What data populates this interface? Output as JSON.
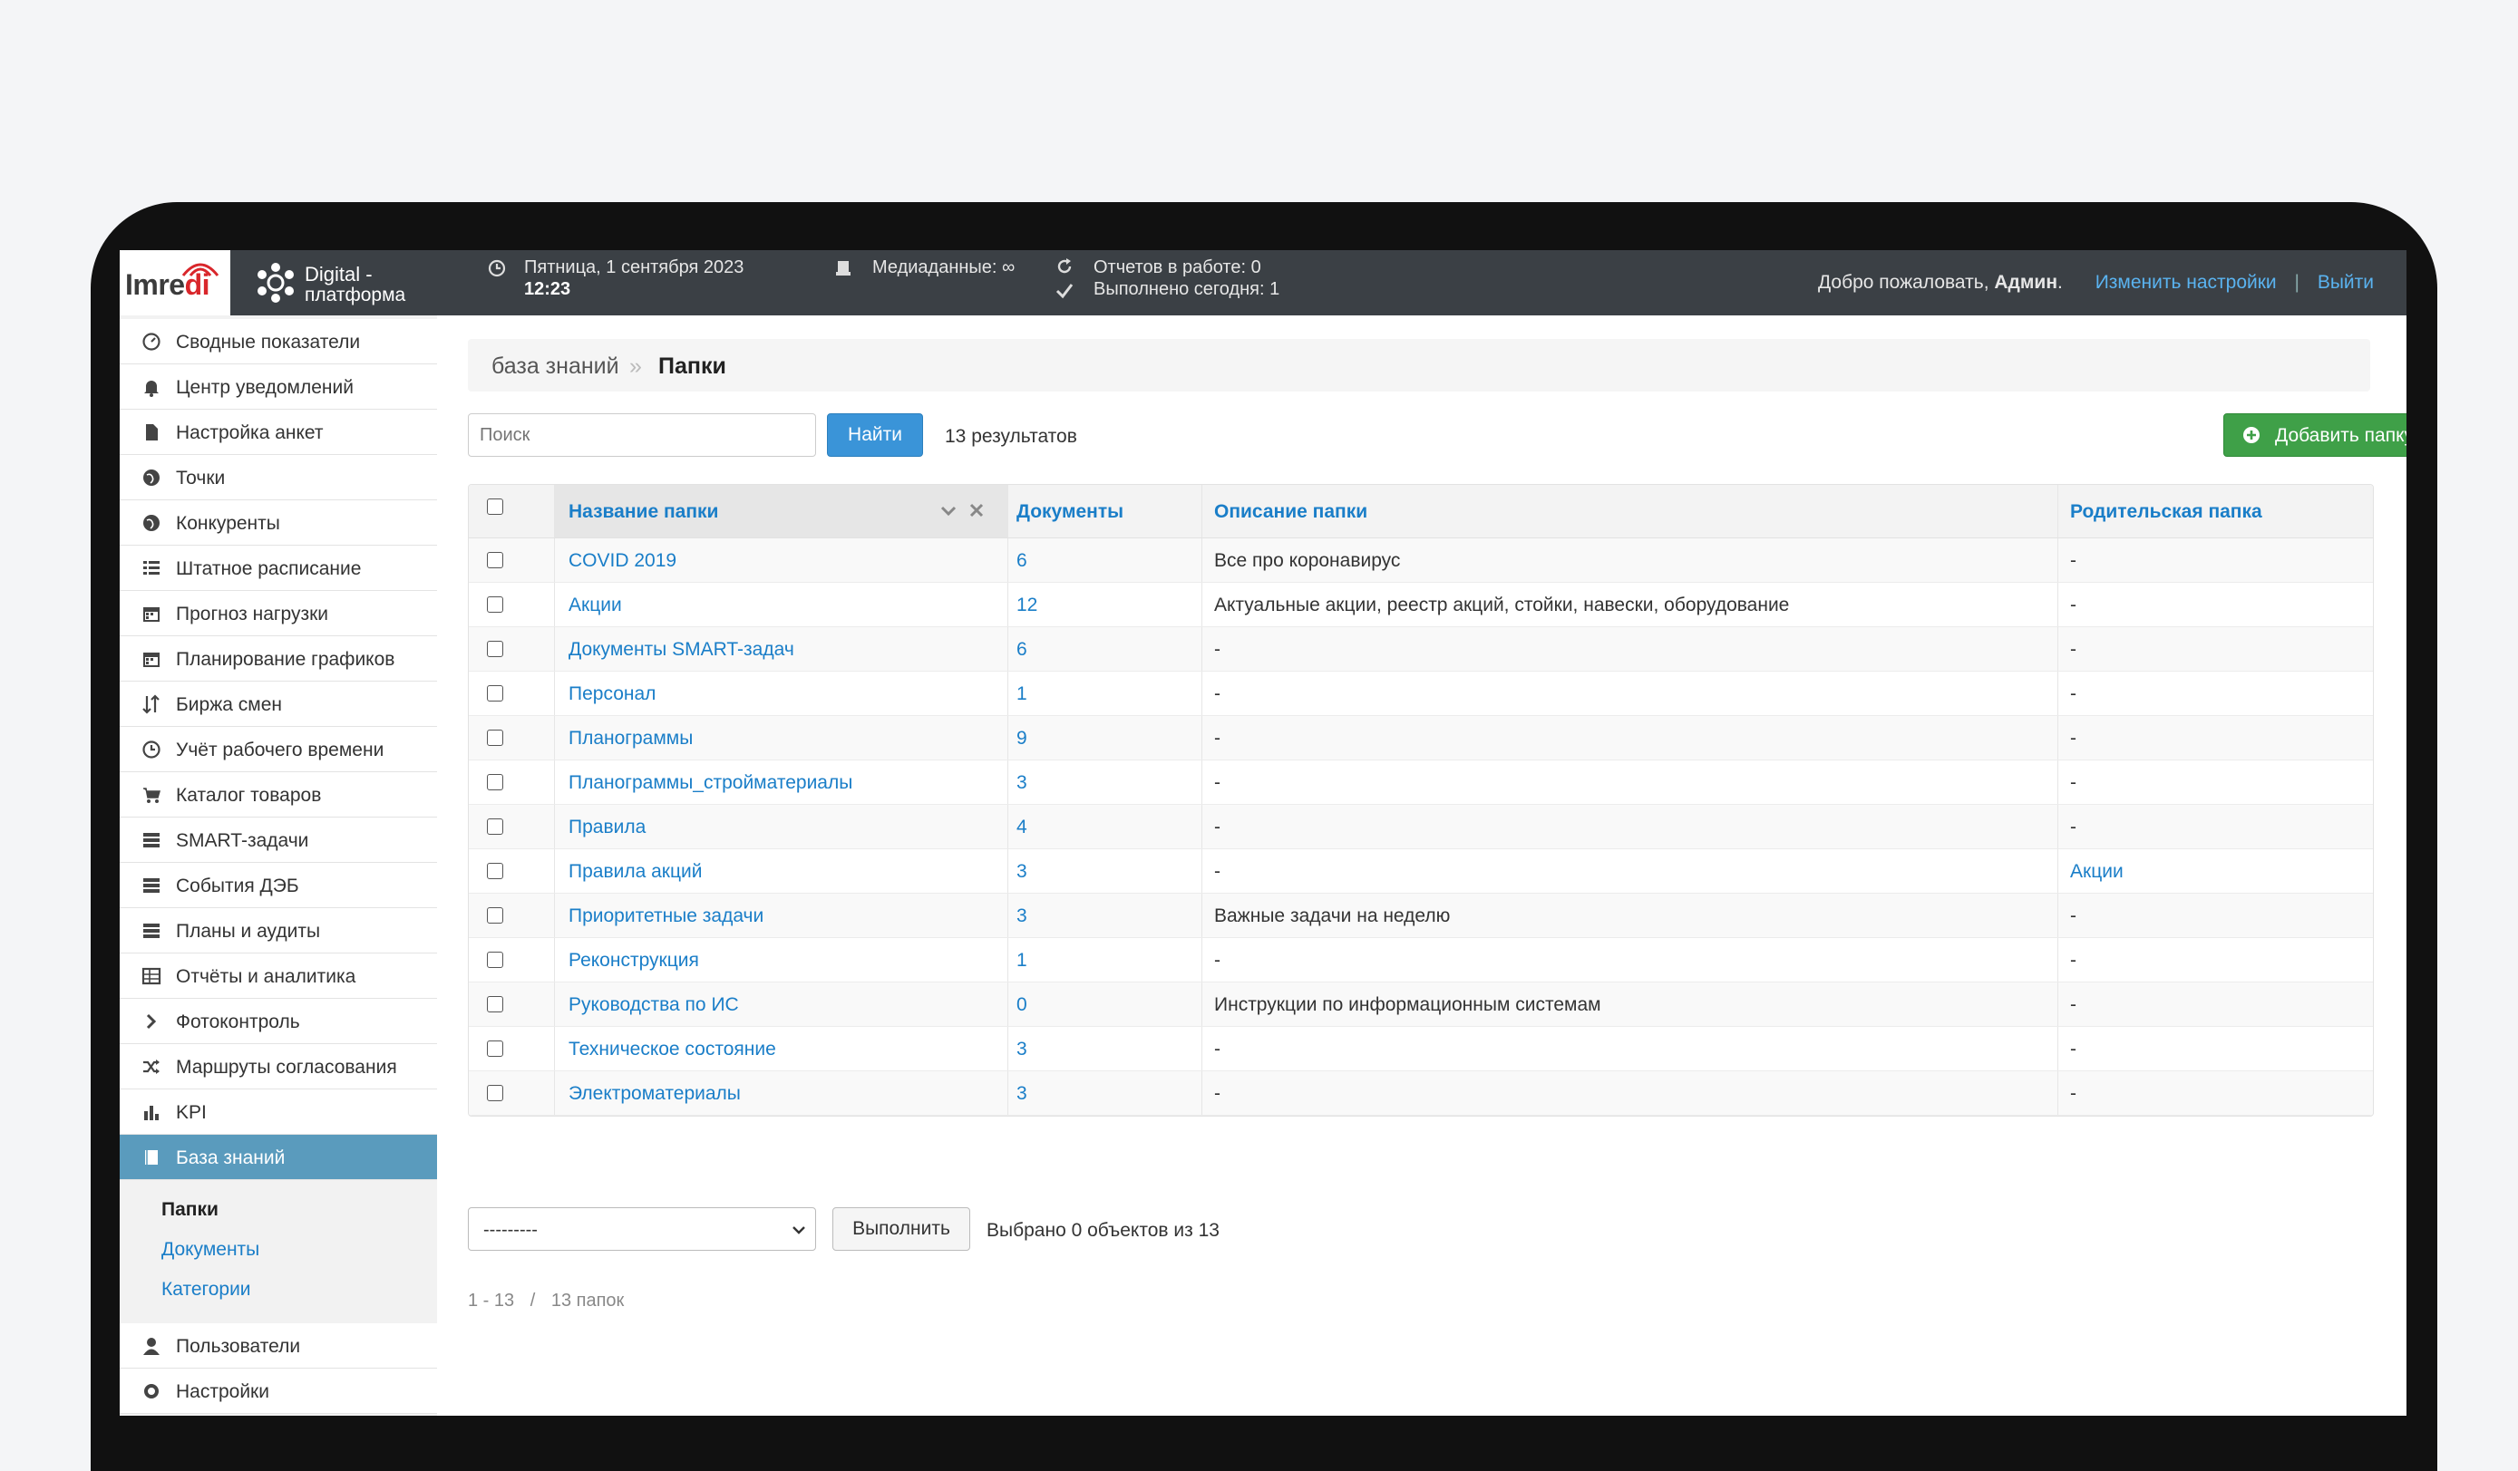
{
  "topbar": {
    "logo_prefix": "Imre",
    "logo_accent": "di",
    "platform_line1": "Digital -",
    "platform_line2": "платформа",
    "date": "Пятница, 1 сентября 2023",
    "time": "12:23",
    "media_label": "Медиаданные: ∞",
    "reports_in_work": "Отчетов в работе: 0",
    "done_today": "Выполнено сегодня: 1",
    "welcome_prefix": "Добро пожаловать, ",
    "welcome_user": "Админ",
    "welcome_suffix": ".",
    "change_settings": "Изменить настройки",
    "separator": "|",
    "logout": "Выйти"
  },
  "sidebar": {
    "items": [
      {
        "label": "Сводные показатели",
        "icon": "dashboard-icon"
      },
      {
        "label": "Центр уведомлений",
        "icon": "bell-icon"
      },
      {
        "label": "Настройка анкет",
        "icon": "file-icon"
      },
      {
        "label": "Точки",
        "icon": "globe-icon"
      },
      {
        "label": "Конкуренты",
        "icon": "globe-icon"
      },
      {
        "label": "Штатное расписание",
        "icon": "list-icon"
      },
      {
        "label": "Прогноз нагрузки",
        "icon": "calendar-icon"
      },
      {
        "label": "Планирование графиков",
        "icon": "calendar-icon"
      },
      {
        "label": "Биржа смен",
        "icon": "swap-vertical-icon"
      },
      {
        "label": "Учёт рабочего времени",
        "icon": "clock-icon"
      },
      {
        "label": "Каталог товаров",
        "icon": "cart-icon"
      },
      {
        "label": "SMART-задачи",
        "icon": "stack-icon"
      },
      {
        "label": "События ДЭБ",
        "icon": "stack-icon"
      },
      {
        "label": "Планы и аудиты",
        "icon": "stack-icon"
      },
      {
        "label": "Отчёты и аналитика",
        "icon": "table-icon"
      },
      {
        "label": "Фотоконтроль",
        "icon": "chevron-right-icon"
      },
      {
        "label": "Маршруты согласования",
        "icon": "shuffle-icon"
      },
      {
        "label": "KPI",
        "icon": "bar-chart-icon"
      },
      {
        "label": "База знаний",
        "icon": "book-icon"
      }
    ],
    "subitems": [
      "Папки",
      "Документы",
      "Категории"
    ],
    "after_items": [
      {
        "label": "Пользователи",
        "icon": "user-icon"
      },
      {
        "label": "Настройки",
        "icon": "gear-icon"
      }
    ]
  },
  "breadcrumb": {
    "parent": "база знаний",
    "separator": "»",
    "current": "Папки"
  },
  "search": {
    "placeholder": "Поиск",
    "button": "Найти",
    "results": "13 результатов"
  },
  "add_button": "Добавить папку",
  "table": {
    "headers": [
      "Название папки",
      "Документы",
      "Описание папки",
      "Родительская папка"
    ],
    "rows": [
      {
        "name": "COVID 2019",
        "docs": "6",
        "desc": "Все про коронавирус",
        "parent": "-"
      },
      {
        "name": "Акции",
        "docs": "12",
        "desc": "Актуальные акции, реестр акций, стойки, навески, оборудование",
        "parent": "-"
      },
      {
        "name": "Документы SMART-задач",
        "docs": "6",
        "desc": "-",
        "parent": "-"
      },
      {
        "name": "Персонал",
        "docs": "1",
        "desc": "-",
        "parent": "-"
      },
      {
        "name": "Планограммы",
        "docs": "9",
        "desc": "-",
        "parent": "-"
      },
      {
        "name": "Планограммы_стройматериалы",
        "docs": "3",
        "desc": "-",
        "parent": "-"
      },
      {
        "name": "Правила",
        "docs": "4",
        "desc": "-",
        "parent": "-"
      },
      {
        "name": "Правила акций",
        "docs": "3",
        "desc": "-",
        "parent": "Акции"
      },
      {
        "name": "Приоритетные задачи",
        "docs": "3",
        "desc": "Важные задачи на неделю",
        "parent": "-"
      },
      {
        "name": "Реконструкция",
        "docs": "1",
        "desc": "-",
        "parent": "-"
      },
      {
        "name": "Руководства по ИС",
        "docs": "0",
        "desc": "Инструкции по информационным системам",
        "parent": "-"
      },
      {
        "name": "Техническое состояние",
        "docs": "3",
        "desc": "-",
        "parent": "-"
      },
      {
        "name": "Электроматериалы",
        "docs": "3",
        "desc": "-",
        "parent": "-"
      }
    ]
  },
  "actions": {
    "select_value": "---------",
    "run_button": "Выполнить",
    "selected_info": "Выбрано 0 объектов из 13"
  },
  "pagination": {
    "range": "1 - 13",
    "separator": "/",
    "total": "13 папок"
  },
  "colors": {
    "link": "#1a7ec8",
    "topbar": "#3b4045",
    "active_nav": "#5a9bbd",
    "add_button": "#3fa048",
    "find_button": "#3a94d8"
  }
}
